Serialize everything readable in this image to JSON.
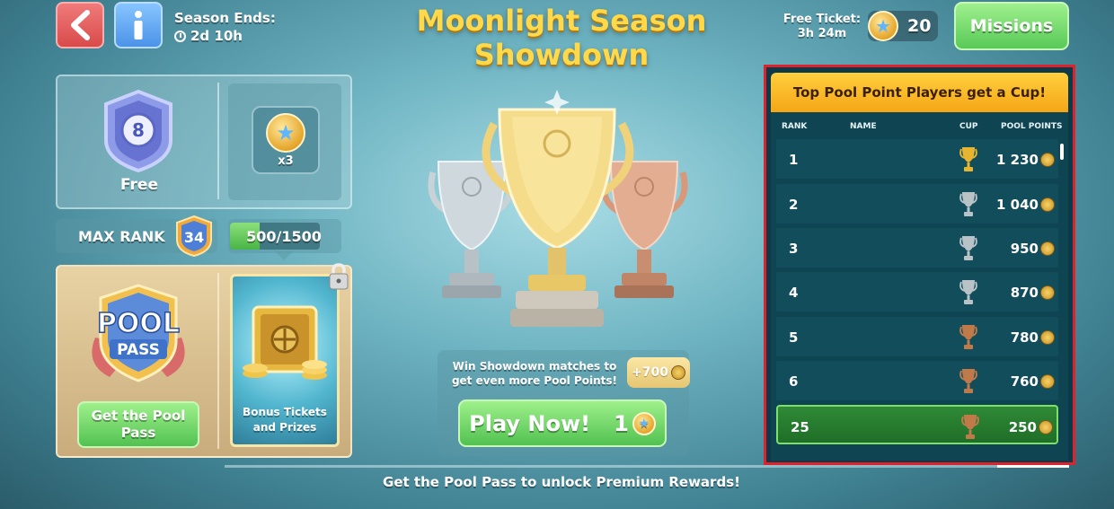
{
  "header": {
    "season_ends_label": "Season Ends:",
    "season_ends_value": "2d 10h",
    "title_line1": "Moonlight Season",
    "title_line2": "Showdown",
    "free_ticket_label": "Free Ticket:",
    "free_ticket_time": "3h 24m",
    "ticket_count": "20",
    "missions_label": "Missions"
  },
  "rewards": {
    "free_label": "Free",
    "badge_number": "8",
    "reward_multiplier": "x3",
    "max_rank_label": "MAX RANK",
    "max_rank_value": "34",
    "progress_text": "500/1500",
    "progress_fraction": 0.333
  },
  "pool_pass": {
    "logo_line1": "POOL",
    "logo_line2": "PASS",
    "get_button_label": "Get the Pool Pass",
    "bonus_label": "Bonus Tickets and Prizes"
  },
  "center": {
    "win_text": "Win Showdown matches to get even more Pool Points!",
    "bonus_points": "+700",
    "play_label": "Play Now!",
    "play_cost": "1"
  },
  "footer": {
    "note": "Get the Pool Pass to unlock Premium Rewards!"
  },
  "leaderboard": {
    "header": "Top Pool Point Players get a Cup!",
    "columns": {
      "rank": "RANK",
      "name": "NAME",
      "cup": "CUP",
      "points": "POOL POINTS"
    },
    "rows": [
      {
        "rank": "1",
        "name": "",
        "cup": "gold",
        "points": "1 230"
      },
      {
        "rank": "2",
        "name": "",
        "cup": "silver",
        "points": "1 040"
      },
      {
        "rank": "3",
        "name": "",
        "cup": "silver",
        "points": "950"
      },
      {
        "rank": "4",
        "name": "",
        "cup": "silver",
        "points": "870"
      },
      {
        "rank": "5",
        "name": "",
        "cup": "bronze",
        "points": "780"
      },
      {
        "rank": "6",
        "name": "",
        "cup": "bronze",
        "points": "760"
      },
      {
        "rank": "25",
        "name": "",
        "cup": "bronze",
        "points": "250",
        "highlighted": true
      }
    ]
  },
  "colors": {
    "accent_gold": "#ffd94a",
    "button_green": "#52c251",
    "back_red": "#d94b4b",
    "info_blue": "#4c93e8",
    "highlight_border": "#e0202a",
    "cup_gold": "#e7b52f",
    "cup_silver": "#b9c2c7",
    "cup_bronze": "#c07a4a"
  },
  "icons": {
    "back": "chevron-left-icon",
    "info": "info-icon",
    "clock": "clock-icon",
    "ticket": "star-coin-icon",
    "lock": "lock-icon",
    "pool_points": "pool-point-icon"
  }
}
